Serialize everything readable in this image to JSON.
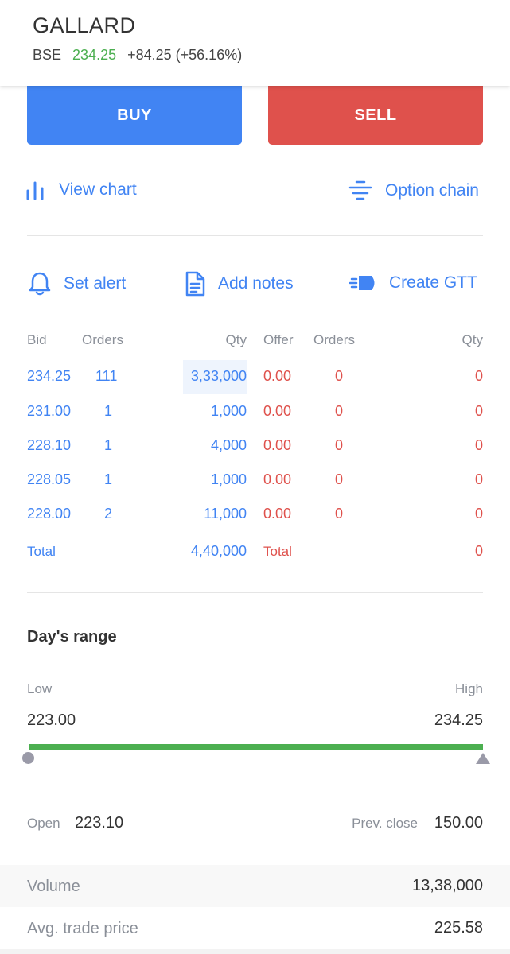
{
  "header": {
    "symbol": "GALLARD",
    "exchange": "BSE",
    "ltp": "234.25",
    "change": "+84.25 (+56.16%)"
  },
  "actions": {
    "buy_label": "BUY",
    "sell_label": "SELL",
    "view_chart": "View chart",
    "option_chain": "Option chain",
    "set_alert": "Set alert",
    "add_notes": "Add notes",
    "create_gtt": "Create GTT"
  },
  "market_depth": {
    "headers": [
      "Bid",
      "Orders",
      "Qty",
      "Offer",
      "Orders",
      "Qty"
    ],
    "rows": [
      {
        "bid": "234.25",
        "bid_orders": "111",
        "bid_qty": "3,33,000",
        "offer": "0.00",
        "offer_orders": "0",
        "offer_qty": "0"
      },
      {
        "bid": "231.00",
        "bid_orders": "1",
        "bid_qty": "1,000",
        "offer": "0.00",
        "offer_orders": "0",
        "offer_qty": "0"
      },
      {
        "bid": "228.10",
        "bid_orders": "1",
        "bid_qty": "4,000",
        "offer": "0.00",
        "offer_orders": "0",
        "offer_qty": "0"
      },
      {
        "bid": "228.05",
        "bid_orders": "1",
        "bid_qty": "1,000",
        "offer": "0.00",
        "offer_orders": "0",
        "offer_qty": "0"
      },
      {
        "bid": "228.00",
        "bid_orders": "2",
        "bid_qty": "11,000",
        "offer": "0.00",
        "offer_orders": "0",
        "offer_qty": "0"
      }
    ],
    "total_label_bid": "Total",
    "total_bid_qty": "4,40,000",
    "total_label_offer": "Total",
    "total_offer_qty": "0"
  },
  "days_range": {
    "title": "Day's range",
    "low_label": "Low",
    "high_label": "High",
    "low": "223.00",
    "high": "234.25"
  },
  "stats": {
    "open_label": "Open",
    "open": "223.10",
    "prev_close_label": "Prev. close",
    "prev_close": "150.00",
    "volume_label": "Volume",
    "volume": "13,38,000",
    "avg_price_label": "Avg. trade price",
    "avg_price": "225.58"
  },
  "colors": {
    "accent_blue": "#4184f3",
    "sell_red": "#df514c",
    "up_green": "#4caf50"
  }
}
